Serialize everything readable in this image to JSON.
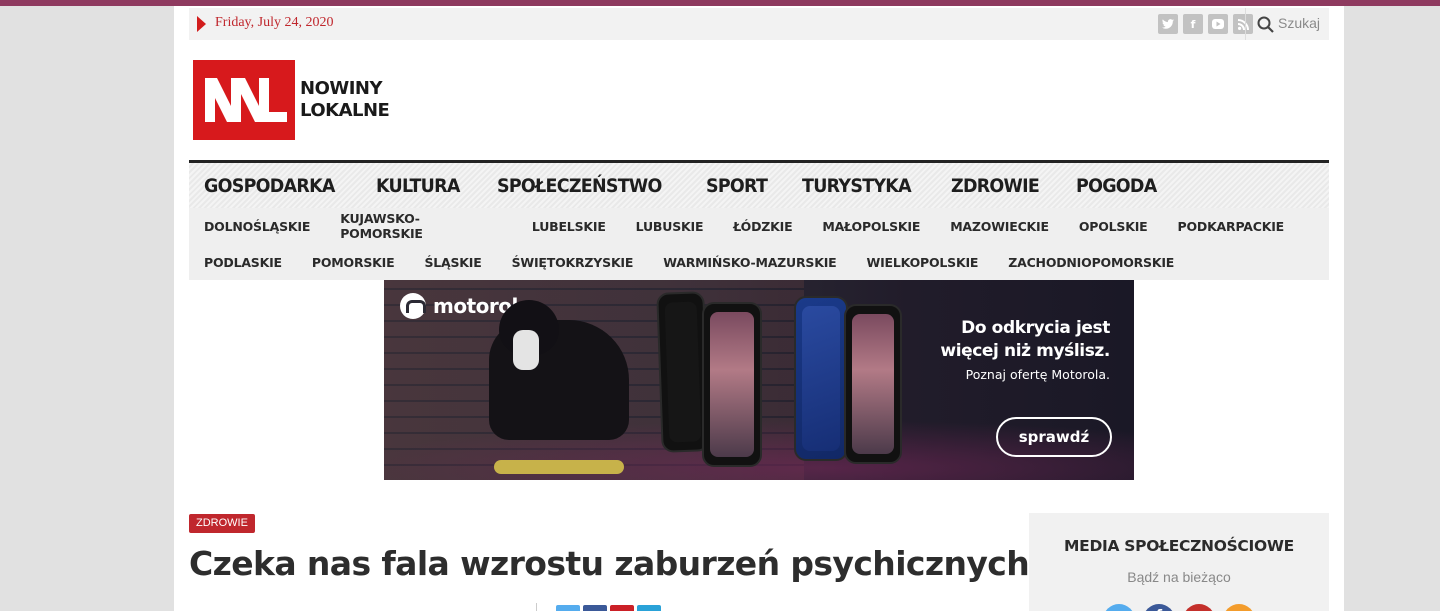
{
  "topbar": {
    "date": "Friday, July 24, 2020",
    "social_icons": [
      "twitter-icon",
      "facebook-icon",
      "youtube-icon",
      "rss-icon"
    ],
    "search_placeholder": "Szukaj"
  },
  "logo": {
    "line1": "NOWINY",
    "line2": "LOKALNE",
    "brand_color": "#d7191c"
  },
  "main_nav": [
    "GOSPODARKA",
    "KULTURA",
    "SPOŁECZEŃSTWO",
    "SPORT",
    "TURYSTYKA",
    "ZDROWIE",
    "POGODA"
  ],
  "regions_row1": [
    "DOLNOŚLĄSKIE",
    "KUJAWSKO-POMORSKIE",
    "LUBELSKIE",
    "LUBUSKIE",
    "ŁÓDZKIE",
    "MAŁOPOLSKIE",
    "MAZOWIECKIE",
    "OPOLSKIE",
    "PODKARPACKIE"
  ],
  "regions_row2": [
    "PODLASKIE",
    "POMORSKIE",
    "ŚLĄSKIE",
    "ŚWIĘTOKRZYSKIE",
    "WARMIŃSKO-MAZURSKIE",
    "WIELKOPOLSKIE",
    "ZACHODNIOPOMORSKIE"
  ],
  "ad": {
    "brand": "motorola",
    "headline_line1": "Do odkrycia jest",
    "headline_line2": "więcej niż myślisz.",
    "subline": "Poznaj ofertę Motorola.",
    "cta": "sprawdź"
  },
  "article": {
    "category": "ZDROWIE",
    "title": "Czeka nas fala wzrostu zaburzeń psychicznych",
    "share_colors": [
      "#55acee",
      "#3b5998",
      "#cb2027",
      "#2aa2d8"
    ]
  },
  "sidebar": {
    "title": "MEDIA SPOŁECZNOŚCIOWE",
    "subtitle": "Bądź na bieżąco",
    "icon_colors": [
      "#55acee",
      "#3b5998",
      "#c4302b",
      "#f39c2c"
    ]
  },
  "colors": {
    "accent": "#c0272d",
    "top_stripe": "#8e3a5f"
  }
}
